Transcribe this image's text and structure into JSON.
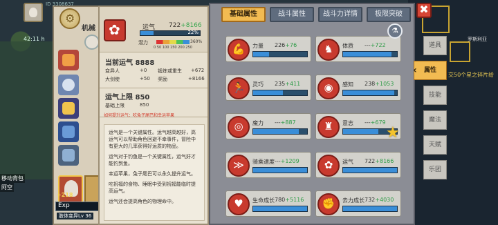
{
  "hud": {
    "top_id": "ID 3308637",
    "time": "42:11 h",
    "right_name": "罗斯利亚",
    "right_quest": "交50个星之碎片给",
    "npc_label_1": "移动背包",
    "npc_label_2": "阿空"
  },
  "character": {
    "name": "机械",
    "level_badge": "+218",
    "exp_label": "Exp",
    "exp_sub": "肢体变异Lv 36"
  },
  "detail": {
    "attr_name": "运气",
    "attr_base": "722",
    "attr_bonus": "+8166",
    "bar_percent": 22,
    "bar_percent_label": "22%",
    "potential_label": "潜力",
    "potential_pct": "360%",
    "potential_ticks": [
      "0",
      "50",
      "100",
      "150",
      "200",
      "250"
    ],
    "current_title": "当前运气 8888",
    "current_rows": [
      {
        "k": "变异人",
        "v": "+0",
        "k2": "锻炼或重生",
        "v2": "+672"
      },
      {
        "k": "大剑使",
        "v": "+50",
        "k2": "奖励",
        "v2": "+8166"
      }
    ],
    "limit_title": "运气上限 850",
    "limit_row": {
      "k": "基础上限",
      "v": "850"
    },
    "hint": "如何提升运气：吃兔子尾巴和幸运苹果",
    "paragraphs": [
      "运气是一个关键属性。运气越高越好，高运气可以帮助角色回避不幸事件，冒险中有更大的几率获得好运质的物品。",
      "运气对于钓鱼是一个关键属性，运气好才能钓到鱼。",
      "幸运苹果，兔子尾巴可以永久提升运气。",
      "吃祝福的食物、睡眠中受到祝福能临时提高运气。",
      "运气还会提高角色的物理命中。"
    ]
  },
  "tabs": [
    {
      "label": "基础属性",
      "active": true
    },
    {
      "label": "战斗属性",
      "active": false
    },
    {
      "label": "战斗力详情",
      "active": false
    },
    {
      "label": "极限突破",
      "active": false
    }
  ],
  "attributes": [
    {
      "label": "力量",
      "base": "226",
      "bonus": "+76",
      "fill": 0.3,
      "icon": "arm-icon",
      "glyph": "💪"
    },
    {
      "label": "体质",
      "base": "---",
      "bonus": "+722",
      "fill": 0.9,
      "icon": "body-icon",
      "glyph": "♞"
    },
    {
      "label": "灵巧",
      "base": "235",
      "bonus": "+411",
      "fill": 0.55,
      "icon": "runner-icon",
      "glyph": "🏃"
    },
    {
      "label": "感知",
      "base": "238",
      "bonus": "+1053",
      "fill": 0.95,
      "icon": "eye-icon",
      "glyph": "◉"
    },
    {
      "label": "魔力",
      "base": "---",
      "bonus": "+887",
      "fill": 0.85,
      "icon": "magic-icon",
      "glyph": "◎"
    },
    {
      "label": "意志",
      "base": "---",
      "bonus": "+679",
      "fill": 0.65,
      "icon": "will-icon",
      "glyph": "♜"
    },
    {
      "label": "骑乘速度",
      "base": "---",
      "bonus": "+1209",
      "fill": 1.0,
      "icon": "speed-icon",
      "glyph": "≫"
    },
    {
      "label": "运气",
      "base": "722",
      "bonus": "+8166",
      "fill": 1.0,
      "icon": "luck-icon",
      "glyph": "✿"
    },
    {
      "label": "生命成长",
      "base": "780",
      "bonus": "+5116",
      "fill": 1.0,
      "icon": "heart-icon",
      "glyph": "♥"
    },
    {
      "label": "去力成长",
      "base": "732",
      "bonus": "+4030",
      "fill": 1.0,
      "icon": "fist-icon",
      "glyph": "✊"
    }
  ],
  "side_menu": [
    {
      "label": "道具",
      "active": false
    },
    {
      "label": "属性",
      "active": true
    },
    {
      "label": "技能",
      "active": false
    },
    {
      "label": "魔法",
      "active": false
    },
    {
      "label": "天赋",
      "active": false
    },
    {
      "label": "乐团",
      "active": false
    }
  ],
  "close_label": "✖",
  "colors": {
    "accent": "#f2bb52",
    "bar": "#3a8ed8",
    "bonus": "#2f9c48",
    "icon": "#c83a2e"
  }
}
